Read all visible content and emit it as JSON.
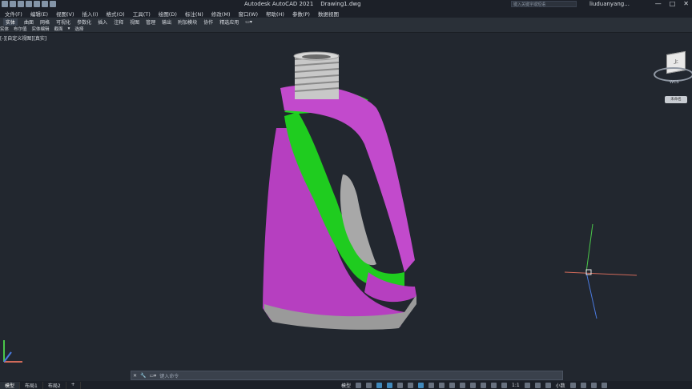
{
  "title": {
    "app": "Autodesk AutoCAD 2021",
    "file": "Drawing1.dwg",
    "search_placeholder": "键入关键字或短语",
    "user": "liuduanyang...",
    "min": "—",
    "max": "□",
    "close": "✕"
  },
  "menu": [
    "文件(F)",
    "编辑(E)",
    "视图(V)",
    "插入(I)",
    "格式(O)",
    "工具(T)",
    "绘图(D)",
    "标注(N)",
    "修改(M)",
    "窗口(W)",
    "帮助(H)",
    "参数(P)",
    "数据视图"
  ],
  "ribbon_tabs": [
    "实体",
    "曲面",
    "网格",
    "可视化",
    "参数化",
    "插入",
    "注释",
    "视图",
    "管理",
    "输出",
    "附加模块",
    "协作",
    "精选应用"
  ],
  "panel_tabs": [
    "实体",
    "布尔值",
    "实体编辑",
    "截面",
    "选择"
  ],
  "viewport_label": "[-][自定义视图][真实]",
  "viewcube": {
    "face": "上",
    "ring_label": "WCS",
    "ring_small": "未命名"
  },
  "commandline": {
    "placeholder": "键入命令"
  },
  "status": {
    "tabs": [
      "模型",
      "布局1",
      "布局2"
    ],
    "add": "+",
    "model_label": "模型",
    "scale": "1:1",
    "units": "小数"
  },
  "colors": {
    "body_magenta": "#b63fc0",
    "inner_green": "#1fcc1f",
    "neck_gray": "#c8c8c8",
    "background": "#22272f"
  }
}
